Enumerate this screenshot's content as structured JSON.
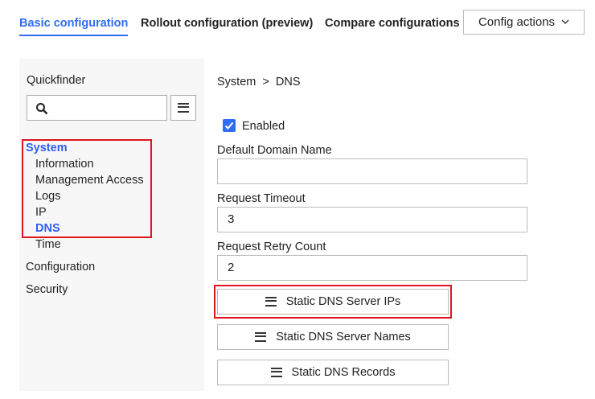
{
  "tabs": [
    {
      "label": "Basic configuration",
      "active": true
    },
    {
      "label": "Rollout configuration (preview)",
      "active": false
    },
    {
      "label": "Compare configurations",
      "active": false
    }
  ],
  "config_actions": {
    "label": "Config actions",
    "icon": "chevron-down-icon"
  },
  "accent_color": "#2f6df5",
  "sidebar": {
    "title": "Quickfinder",
    "search": {
      "value": "",
      "icon": "search-icon"
    },
    "menu_icon": "hamburger-icon",
    "items": [
      {
        "label": "System",
        "selected": true
      },
      {
        "label": "Information"
      },
      {
        "label": "Management Access"
      },
      {
        "label": "Logs"
      },
      {
        "label": "IP"
      },
      {
        "label": "DNS",
        "selected": true
      },
      {
        "label": "Time"
      },
      {
        "label": "Configuration"
      },
      {
        "label": "Security"
      }
    ]
  },
  "breadcrumb": {
    "parent": "System",
    "separator": ">",
    "current": "DNS"
  },
  "form": {
    "enabled": {
      "label": "Enabled",
      "checked": true
    },
    "default_domain": {
      "label": "Default Domain Name",
      "value": ""
    },
    "timeout": {
      "label": "Request Timeout",
      "value": "3"
    },
    "retry": {
      "label": "Request Retry Count",
      "value": "2"
    },
    "buttons": [
      "Static DNS Server IPs",
      "Static DNS Server Names",
      "Static DNS Records"
    ]
  },
  "highlight_color": "#e0141e"
}
